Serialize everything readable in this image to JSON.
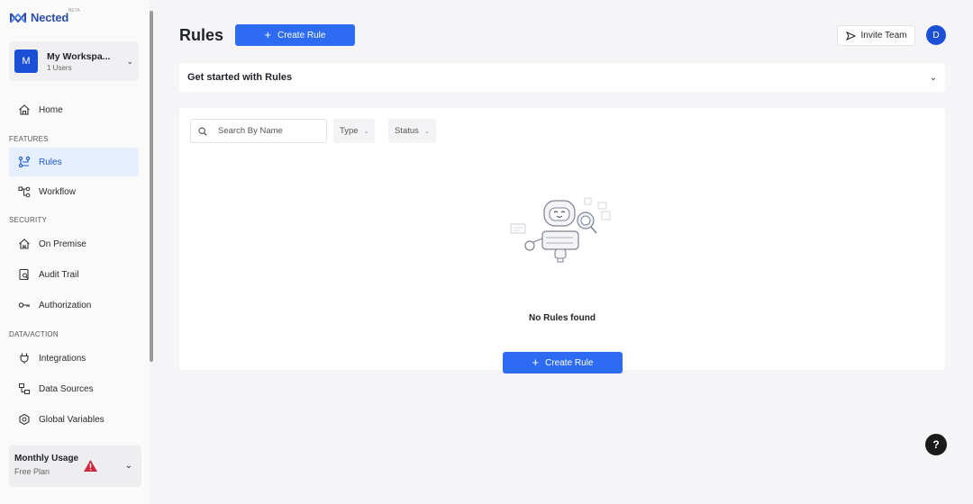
{
  "brand": {
    "name": "Nected",
    "tag": "BETA"
  },
  "workspace": {
    "avatar_letter": "M",
    "name": "My Workspa...",
    "users": "1 Users"
  },
  "sidebar": {
    "home": "Home",
    "sections": {
      "features": "FEATURES",
      "security": "SECURITY",
      "data_action": "DATA/ACTION"
    },
    "items": [
      {
        "label": "Home",
        "icon": "home-icon"
      },
      {
        "label": "Rules",
        "icon": "rules-icon",
        "active": true
      },
      {
        "label": "Workflow",
        "icon": "workflow-icon"
      },
      {
        "label": "On Premise",
        "icon": "on-premise-icon"
      },
      {
        "label": "Audit Trail",
        "icon": "audit-trail-icon"
      },
      {
        "label": "Authorization",
        "icon": "key-icon"
      },
      {
        "label": "Integrations",
        "icon": "plug-icon"
      },
      {
        "label": "Data Sources",
        "icon": "data-sources-icon"
      },
      {
        "label": "Global Variables",
        "icon": "global-variables-icon"
      }
    ],
    "usage": {
      "title": "Monthly Usage",
      "plan": "Free Plan"
    }
  },
  "header": {
    "title": "Rules",
    "create_label": "Create Rule",
    "invite_label": "Invite Team",
    "user_initial": "D"
  },
  "get_started": {
    "title": "Get started with Rules"
  },
  "filters": {
    "search_placeholder": "Search By Name",
    "type_label": "Type",
    "status_label": "Status"
  },
  "empty_state": {
    "message": "No Rules found",
    "create_label": "Create Rule"
  },
  "help": {
    "label": "?"
  },
  "colors": {
    "accent": "#2d6cf2",
    "brand": "#1b4fd6",
    "active_bg": "#e6effd",
    "warning": "#d3263c"
  }
}
